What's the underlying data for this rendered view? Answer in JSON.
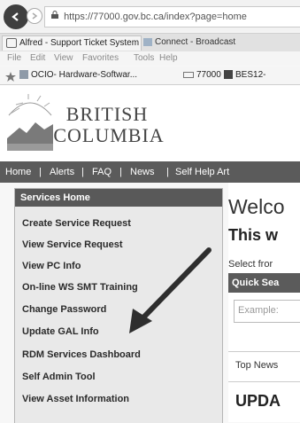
{
  "browser": {
    "url_display": "https://77000.gov.bc.ca/index?page=home",
    "tabs": [
      {
        "label": "Alfred - Support Ticket System"
      },
      {
        "label": "Connect - Broadcast"
      }
    ],
    "menu": [
      "File",
      "Edit",
      "View",
      "Favorites",
      "Tools",
      "Help"
    ],
    "favorites": [
      {
        "label": "OCIO- Hardware-Softwar..."
      },
      {
        "label": "77000"
      },
      {
        "label": "BES12-"
      }
    ]
  },
  "site": {
    "logo_line1": "BRITISH",
    "logo_line2": "COLUMBIA",
    "nav": [
      "Home",
      "|",
      "Alerts",
      "|",
      "FAQ",
      "|",
      "News",
      "|",
      "Self Help Art"
    ]
  },
  "sidebar": {
    "header": "Services Home",
    "items": [
      "Create Service Request",
      "View Service Request",
      "View PC Info",
      "On-line WS SMT Training",
      "Change Password",
      "Update GAL Info",
      "RDM Services Dashboard",
      "Self Admin Tool",
      "View Asset Information"
    ]
  },
  "main": {
    "welcome": "Welco",
    "subheading": "This w",
    "select_text": "Select fror",
    "quick_search": "Quick Sea",
    "search_placeholder": "Example:",
    "top_news": "Top News",
    "update": "UPDA"
  }
}
